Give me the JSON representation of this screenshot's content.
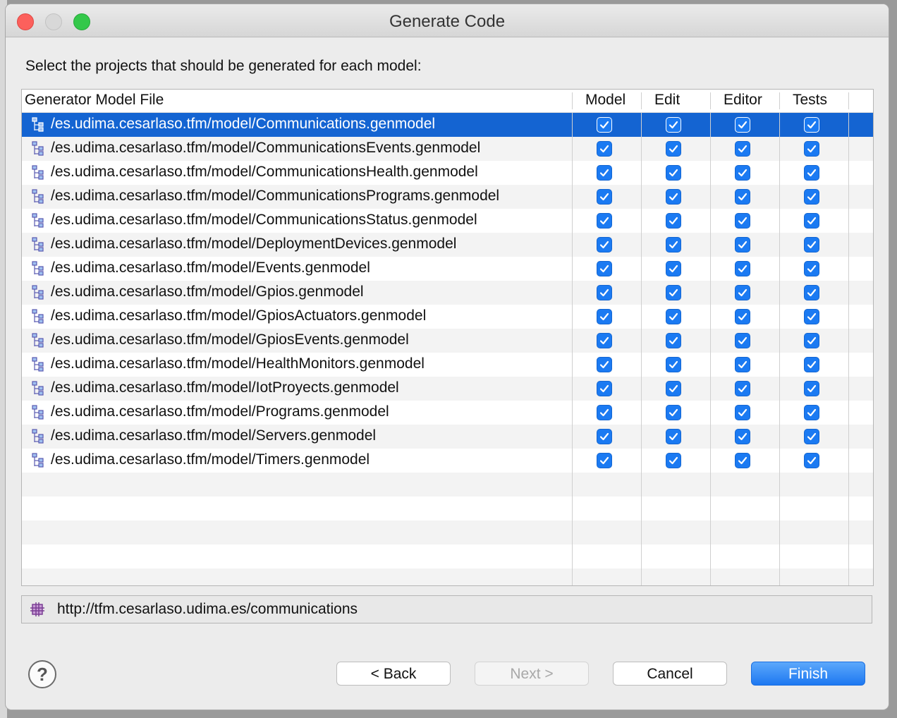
{
  "window": {
    "title": "Generate Code"
  },
  "instruction": "Select the projects that should be generated for each model:",
  "table": {
    "columns": {
      "file": "Generator Model File",
      "model": "Model",
      "edit": "Edit",
      "editor": "Editor",
      "tests": "Tests"
    },
    "rows": [
      {
        "file": "/es.udima.cesarlaso.tfm/model/Communications.genmodel",
        "model": true,
        "edit": true,
        "editor": true,
        "tests": true,
        "selected": true
      },
      {
        "file": "/es.udima.cesarlaso.tfm/model/CommunicationsEvents.genmodel",
        "model": true,
        "edit": true,
        "editor": true,
        "tests": true
      },
      {
        "file": "/es.udima.cesarlaso.tfm/model/CommunicationsHealth.genmodel",
        "model": true,
        "edit": true,
        "editor": true,
        "tests": true
      },
      {
        "file": "/es.udima.cesarlaso.tfm/model/CommunicationsPrograms.genmodel",
        "model": true,
        "edit": true,
        "editor": true,
        "tests": true
      },
      {
        "file": "/es.udima.cesarlaso.tfm/model/CommunicationsStatus.genmodel",
        "model": true,
        "edit": true,
        "editor": true,
        "tests": true
      },
      {
        "file": "/es.udima.cesarlaso.tfm/model/DeploymentDevices.genmodel",
        "model": true,
        "edit": true,
        "editor": true,
        "tests": true
      },
      {
        "file": "/es.udima.cesarlaso.tfm/model/Events.genmodel",
        "model": true,
        "edit": true,
        "editor": true,
        "tests": true
      },
      {
        "file": "/es.udima.cesarlaso.tfm/model/Gpios.genmodel",
        "model": true,
        "edit": true,
        "editor": true,
        "tests": true
      },
      {
        "file": "/es.udima.cesarlaso.tfm/model/GpiosActuators.genmodel",
        "model": true,
        "edit": true,
        "editor": true,
        "tests": true
      },
      {
        "file": "/es.udima.cesarlaso.tfm/model/GpiosEvents.genmodel",
        "model": true,
        "edit": true,
        "editor": true,
        "tests": true
      },
      {
        "file": "/es.udima.cesarlaso.tfm/model/HealthMonitors.genmodel",
        "model": true,
        "edit": true,
        "editor": true,
        "tests": true
      },
      {
        "file": "/es.udima.cesarlaso.tfm/model/IotProyects.genmodel",
        "model": true,
        "edit": true,
        "editor": true,
        "tests": true
      },
      {
        "file": "/es.udima.cesarlaso.tfm/model/Programs.genmodel",
        "model": true,
        "edit": true,
        "editor": true,
        "tests": true
      },
      {
        "file": "/es.udima.cesarlaso.tfm/model/Servers.genmodel",
        "model": true,
        "edit": true,
        "editor": true,
        "tests": true
      },
      {
        "file": "/es.udima.cesarlaso.tfm/model/Timers.genmodel",
        "model": true,
        "edit": true,
        "editor": true,
        "tests": true
      }
    ]
  },
  "package_uri": "http://tfm.cesarlaso.udima.es/communications",
  "buttons": {
    "help": "?",
    "back": "< Back",
    "next": "Next >",
    "cancel": "Cancel",
    "finish": "Finish"
  },
  "colors": {
    "selection": "#1464d2",
    "checkbox": "#1b7af2",
    "primary_button": "#1d78f1"
  },
  "icons": {
    "file": "genmodel-tree-icon",
    "uri": "package-grid-icon",
    "check": "checkmark-icon",
    "help": "help-icon"
  }
}
